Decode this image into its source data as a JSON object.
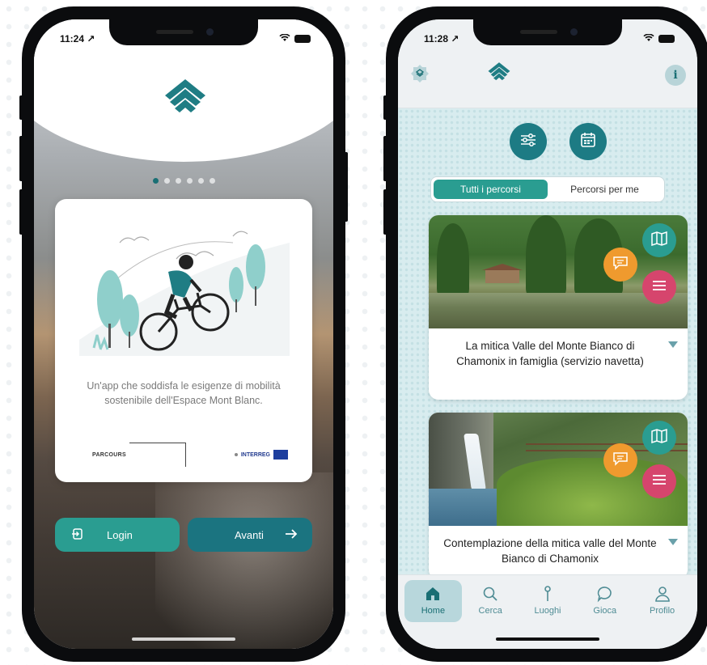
{
  "left_phone": {
    "status": {
      "time": "11:24 ↗"
    },
    "pager_total": 6,
    "pager_active": 0,
    "card": {
      "description": "Un'app che soddisfa le esigenze di mobilità sostenibile dell'Espace Mont Blanc.",
      "partner_1": "PARCOURS",
      "partner_2": "INTERREG"
    },
    "buttons": {
      "login_label": "Login",
      "next_label": "Avanti"
    }
  },
  "right_phone": {
    "status": {
      "time": "11:28 ↗"
    },
    "header": {
      "info_label": "i"
    },
    "segmented": {
      "all_label": "Tutti i percorsi",
      "mine_label": "Percorsi per me",
      "selected": "all"
    },
    "routes": [
      {
        "title": "La mitica Valle del Monte Bianco di Chamonix in famiglia (servizio navetta)"
      },
      {
        "title": "Contemplazione della mitica valle del Monte Bianco di Chamonix"
      }
    ],
    "tabbar": {
      "items": [
        {
          "label": "Home",
          "icon": "home-icon",
          "active": true
        },
        {
          "label": "Cerca",
          "icon": "search-icon",
          "active": false
        },
        {
          "label": "Luoghi",
          "icon": "pin-icon",
          "active": false
        },
        {
          "label": "Gioca",
          "icon": "chat-icon",
          "active": false
        },
        {
          "label": "Profilo",
          "icon": "user-icon",
          "active": false
        }
      ]
    }
  },
  "colors": {
    "teal": "#2a9d91",
    "dark_teal": "#1b7480",
    "orange": "#ef9a2e",
    "pink": "#d6456d"
  }
}
